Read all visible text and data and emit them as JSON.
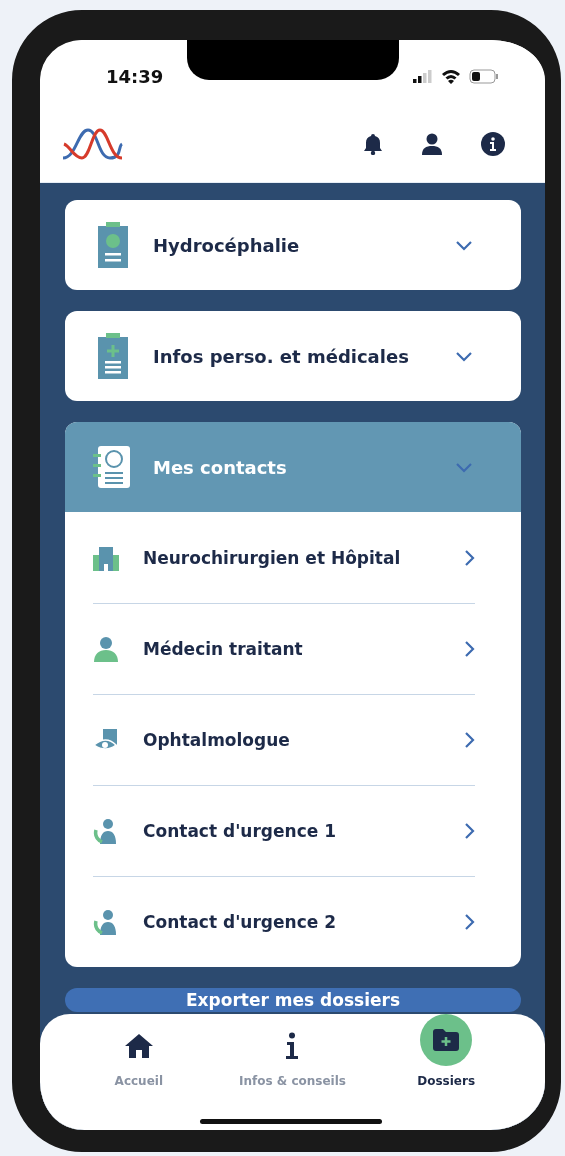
{
  "status_bar": {
    "time": "14:39"
  },
  "sections": [
    {
      "title": "Hydrocéphalie",
      "kind": "brain",
      "expanded": false
    },
    {
      "title": "Infos perso. et médicales",
      "kind": "plus",
      "expanded": false
    },
    {
      "title": "Mes contacts",
      "kind": "contacts",
      "expanded": true,
      "items": [
        {
          "label": "Neurochirurgien et Hôpital",
          "kind": "hospital"
        },
        {
          "label": "Médecin traitant",
          "kind": "doctor"
        },
        {
          "label": "Ophtalmologue",
          "kind": "eye"
        },
        {
          "label": "Contact d'urgence 1",
          "kind": "phone"
        },
        {
          "label": "Contact d'urgence 2",
          "kind": "phone"
        }
      ]
    }
  ],
  "export_button": {
    "label": "Exporter mes dossiers"
  },
  "nav": [
    {
      "label": "Accueil",
      "kind": "home",
      "selected": false
    },
    {
      "label": "Infos & conseils",
      "kind": "info",
      "selected": false
    },
    {
      "label": "Dossiers",
      "kind": "folder",
      "selected": true
    }
  ]
}
